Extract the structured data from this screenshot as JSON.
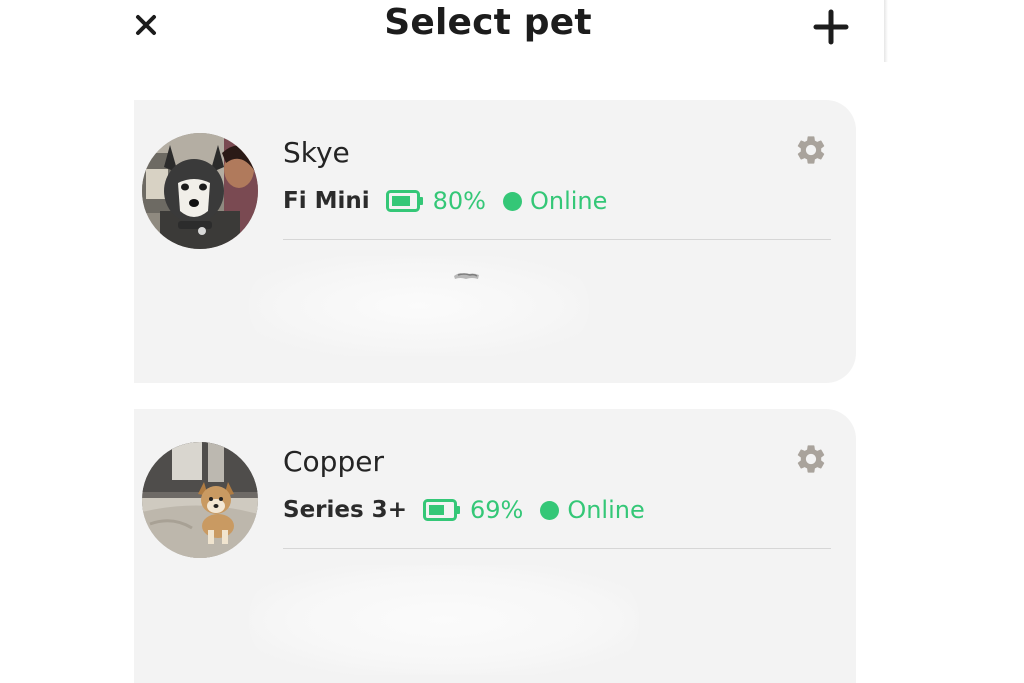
{
  "header": {
    "title": "Select pet",
    "close_icon": "close-icon",
    "add_icon": "plus-icon"
  },
  "colors": {
    "online_green": "#34c777",
    "card_bg": "#f3f3f3",
    "gear_gray": "#a9a39c"
  },
  "pets": [
    {
      "name": "Skye",
      "device": "Fi Mini",
      "battery": "80%",
      "battery_level": 0.8,
      "status": "Online",
      "settings_icon": "gear-icon"
    },
    {
      "name": "Copper",
      "device": "Series 3+",
      "battery": "69%",
      "battery_level": 0.69,
      "status": "Online",
      "settings_icon": "gear-icon"
    }
  ]
}
